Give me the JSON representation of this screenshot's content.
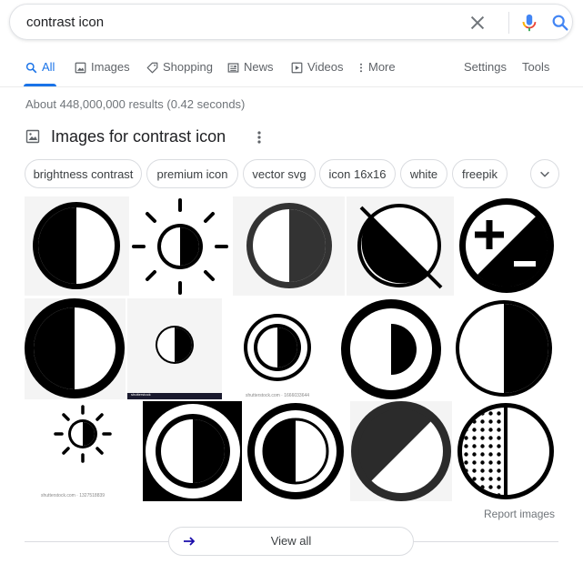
{
  "search": {
    "query": "contrast icon",
    "icons": {
      "clear": "close-icon",
      "voice": "microphone-icon",
      "submit": "search-icon"
    }
  },
  "tabs": [
    {
      "label": "All",
      "icon": "search-icon",
      "active": true
    },
    {
      "label": "Images",
      "icon": "image-icon"
    },
    {
      "label": "Shopping",
      "icon": "tag-icon"
    },
    {
      "label": "News",
      "icon": "newspaper-icon"
    },
    {
      "label": "Videos",
      "icon": "play-icon"
    },
    {
      "label": "More",
      "icon": "more-vert-icon"
    },
    {
      "label": "Settings"
    },
    {
      "label": "Tools"
    }
  ],
  "stats": "About 448,000,000 results (0.42 seconds)",
  "images_section": {
    "title": "Images for contrast icon",
    "chips": [
      "brightness contrast",
      "premium icon",
      "vector svg",
      "icon 16x16",
      "white",
      "freepik"
    ],
    "watermarks": {
      "row2_tile2": "shutterstock",
      "row2_tile3": "shutterstock.com · 1666033644",
      "row3_tile1": "shutterstock.com · 1327518839"
    },
    "report_label": "Report images",
    "view_all_label": "View all"
  },
  "colors": {
    "accent": "#1a73e8",
    "mic_red": "#ea4335",
    "mic_yellow": "#fbbc04",
    "mic_green": "#34a853",
    "view_all_arrow": "#1a0dab"
  }
}
